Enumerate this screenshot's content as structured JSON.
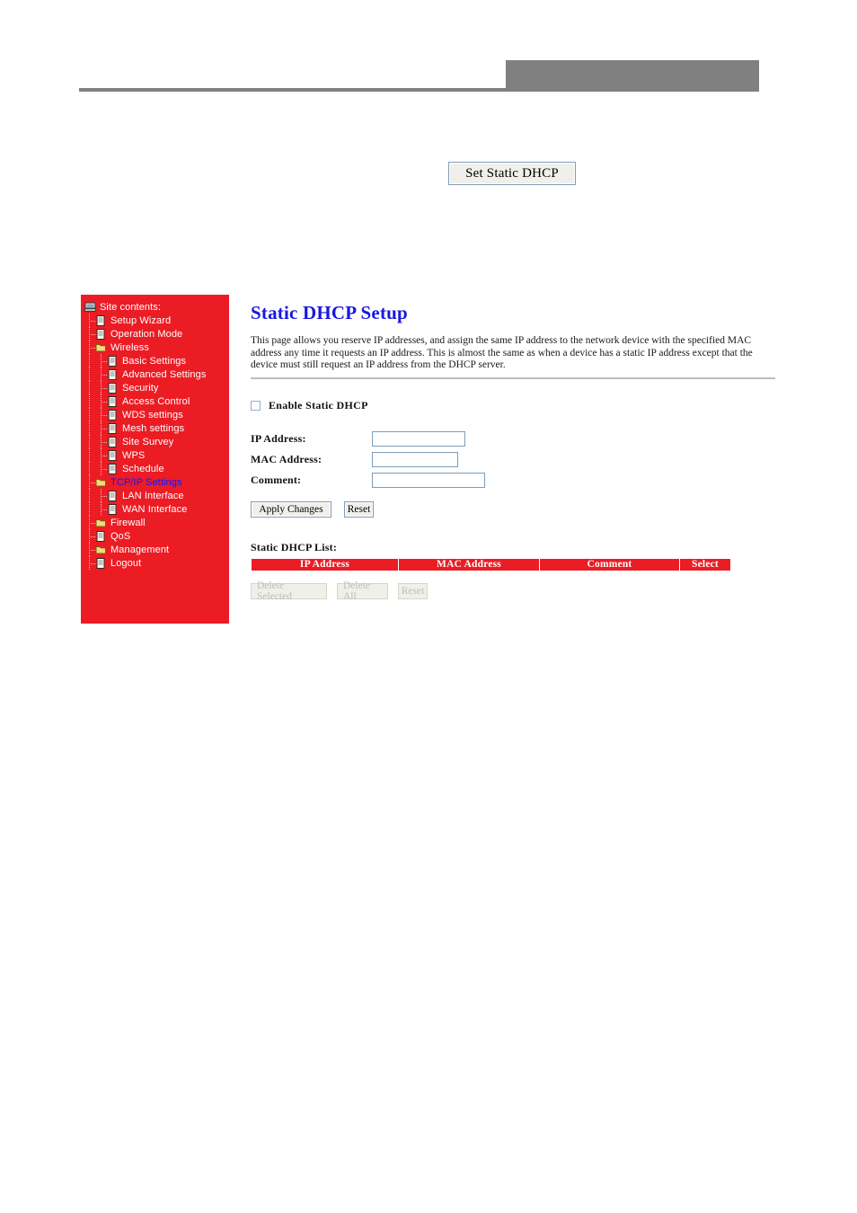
{
  "header": {
    "gray_box": "",
    "rule": ""
  },
  "top_button": {
    "label": "Set Static DHCP",
    "name": "set-static-dhcp-button"
  },
  "sidebar": {
    "background_color": "#ec1c24",
    "selected_color": "#1414ff",
    "root": {
      "label": "Site contents:",
      "icon": "computer-icon"
    },
    "items": [
      {
        "label": "Setup Wizard",
        "icon": "page-icon",
        "level": 1,
        "selected": false
      },
      {
        "label": "Operation Mode",
        "icon": "page-icon",
        "level": 1,
        "selected": false
      },
      {
        "label": "Wireless",
        "icon": "folder-icon",
        "level": 1,
        "selected": false
      },
      {
        "label": "Basic Settings",
        "icon": "page-icon",
        "level": 2,
        "selected": false
      },
      {
        "label": "Advanced Settings",
        "icon": "page-icon",
        "level": 2,
        "selected": false
      },
      {
        "label": "Security",
        "icon": "page-icon",
        "level": 2,
        "selected": false
      },
      {
        "label": "Access Control",
        "icon": "page-icon",
        "level": 2,
        "selected": false
      },
      {
        "label": "WDS settings",
        "icon": "page-icon",
        "level": 2,
        "selected": false
      },
      {
        "label": "Mesh settings",
        "icon": "page-icon",
        "level": 2,
        "selected": false
      },
      {
        "label": "Site Survey",
        "icon": "page-icon",
        "level": 2,
        "selected": false
      },
      {
        "label": "WPS",
        "icon": "page-icon",
        "level": 2,
        "selected": false
      },
      {
        "label": "Schedule",
        "icon": "page-icon",
        "level": 2,
        "selected": false
      },
      {
        "label": "TCP/IP Settings",
        "icon": "folder-icon",
        "level": 1,
        "selected": true
      },
      {
        "label": "LAN Interface",
        "icon": "page-icon",
        "level": 2,
        "selected": false
      },
      {
        "label": "WAN Interface",
        "icon": "page-icon",
        "level": 2,
        "selected": false
      },
      {
        "label": "Firewall",
        "icon": "folder-icon",
        "level": 1,
        "selected": false
      },
      {
        "label": "QoS",
        "icon": "page-icon",
        "level": 1,
        "selected": false
      },
      {
        "label": "Management",
        "icon": "folder-icon",
        "level": 1,
        "selected": false
      },
      {
        "label": "Logout",
        "icon": "page-icon",
        "level": 1,
        "selected": false
      }
    ]
  },
  "content": {
    "title": "Static DHCP Setup",
    "title_color": "#1818e0",
    "description": "This page allows you reserve IP addresses, and assign the same IP address to the network device with the specified MAC address any time it requests an IP address. This is almost the same as when a device has a static IP address except that the device must still request an IP address from the DHCP server.",
    "enable_checkbox": {
      "label": "Enable Static DHCP",
      "checked": false
    },
    "fields": {
      "ip_address": {
        "label": "IP Address:",
        "value": "",
        "placeholder": ""
      },
      "mac_address": {
        "label": "MAC Address:",
        "value": "",
        "placeholder": ""
      },
      "comment": {
        "label": "Comment:",
        "value": "",
        "placeholder": ""
      }
    },
    "buttons": {
      "apply_changes": "Apply Changes",
      "reset_top": "Reset"
    },
    "list": {
      "caption": "Static DHCP List:",
      "columns": [
        "IP Address",
        "MAC Address",
        "Comment",
        "Select"
      ],
      "header_color": "#ec1c24",
      "rows": []
    },
    "list_buttons": {
      "delete_selected": "Delete Selected",
      "delete_all": "Delete All",
      "reset_bottom": "Reset",
      "disabled": true
    }
  }
}
